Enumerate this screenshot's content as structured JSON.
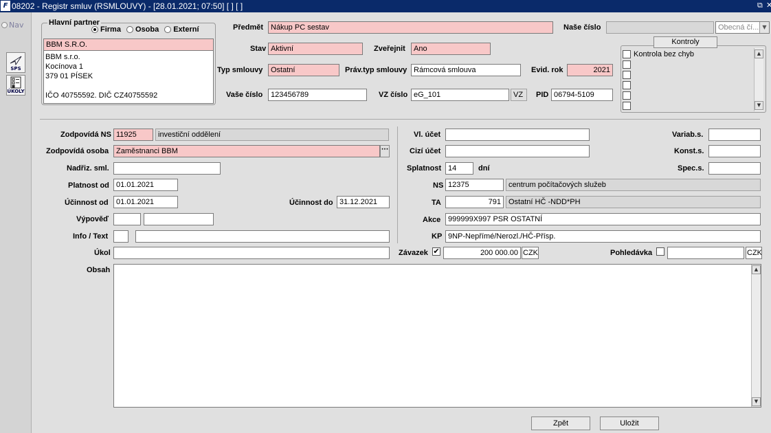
{
  "window": {
    "title": "08202 - Registr smluv (RSMLOUVY) - [28.01.2021; 07:50]  [ ]  [ ]",
    "app_icon": "F",
    "controls": [
      "⧉",
      "✕"
    ]
  },
  "leftbar": {
    "nav_label": "Nav",
    "sps_label": "SPS",
    "ukoly_label": "ÚKOLY"
  },
  "partner": {
    "legend": "Hlavní partner",
    "options": [
      "Firma",
      "Osoba",
      "Externí"
    ],
    "selected": "Firma",
    "name": "BBM S.R.O.",
    "address_lines": [
      "BBM s.r.o.",
      "Kocínova 1",
      "379 01 PÍSEK",
      "",
      "IČO 40755592. DIČ CZ40755592"
    ]
  },
  "header": {
    "predmet_label": "Předmět",
    "predmet_value": "Nákup PC sestav",
    "nase_cislo_label": "Naše číslo",
    "nase_cislo_value": "",
    "obecna_value": "Obecná čí...",
    "stav_label": "Stav",
    "stav_value": "Aktivní",
    "zverejnit_label": "Zveřejnit",
    "zverejnit_value": "Ano",
    "typ_label": "Typ smlouvy",
    "typ_value": "Ostatní",
    "pravtyp_label": "Práv.typ smlouvy",
    "pravtyp_value": "Rámcová smlouva",
    "evid_label": "Evid. rok",
    "evid_value": "2021",
    "vase_label": "Vaše číslo",
    "vase_value": "123456789",
    "vz_label": "VZ číslo",
    "vz_value": "eG_101",
    "vz_badge": "VZ",
    "pid_label": "PID",
    "pid_value": "06794-5109"
  },
  "kontroly": {
    "button": "Kontroly",
    "items": [
      "Kontrola bez chyb",
      "",
      "",
      "",
      "",
      ""
    ]
  },
  "left_form": {
    "zodp_ns_label": "Zodpovídá NS",
    "zodp_ns_code": "11925",
    "zodp_ns_name": "investiční oddělení",
    "zodp_osoba_label": "Zodpovídá osoba",
    "zodp_osoba_value": "Zaměstnanci BBM",
    "nadriz_label": "Nadřiz. sml.",
    "nadriz_value": "",
    "platnost_label": "Platnost od",
    "platnost_value": "01.01.2021",
    "ucinnost_od_label": "Účinnost od",
    "ucinnost_od_value": "01.01.2021",
    "ucinnost_do_label": "Účinnost do",
    "ucinnost_do_value": "31.12.2021",
    "vypoved_label": "Výpověď",
    "info_label": "Info / Text",
    "ukol_label": "Úkol",
    "obsah_label": "Obsah"
  },
  "right_form": {
    "vl_ucet_label": "Vl. účet",
    "cizi_ucet_label": "Cizí účet",
    "splatnost_label": "Splatnost",
    "splatnost_value": "14",
    "dni_label": "dní",
    "variab_label": "Variab.s.",
    "konst_label": "Konst.s.",
    "spec_label": "Spec.s.",
    "ns_label": "NS",
    "ns_code": "12375",
    "ns_name": "centrum počítačových služeb",
    "ta_label": "TA",
    "ta_code": "791",
    "ta_name": "Ostatní HČ -NDD*PH",
    "akce_label": "Akce",
    "akce_value": "999999X997 PSR OSTATNÍ",
    "kp_label": "KP",
    "kp_value": "9NP-Nepřímé/Nerozl./HČ-Přísp.",
    "zavazek_label": "Závazek",
    "zavazek_checked": "✔",
    "zavazek_value": "200 000.00",
    "zavazek_cur": "CZK",
    "pohledavka_label": "Pohledávka",
    "pohledavka_value": "",
    "pohledavka_cur": "CZK"
  },
  "footer": {
    "back": "Zpět",
    "save": "Uložit"
  }
}
